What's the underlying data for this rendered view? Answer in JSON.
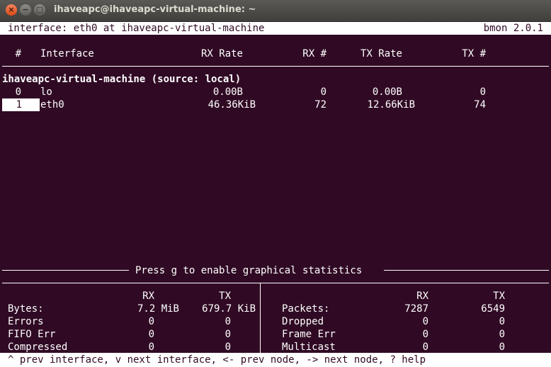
{
  "window": {
    "title": "ihaveapc@ihaveapc-virtual-machine: ~",
    "close_glyph": "×",
    "minimize_glyph": "−",
    "maximize_glyph": "□"
  },
  "status": {
    "left": "interface: eth0 at ihaveapc-virtual-machine",
    "right": "bmon 2.0.1"
  },
  "table": {
    "headers": [
      "#",
      "Interface",
      "RX Rate",
      "RX #",
      "TX Rate",
      "TX #"
    ],
    "host": "ihaveapc-virtual-machine (source: local)",
    "rows": [
      {
        "index": "0",
        "name": "lo",
        "rx_rate": "0.00B",
        "rx_count": "0",
        "tx_rate": "0.00B",
        "tx_count": "0",
        "selected": false
      },
      {
        "index": "1",
        "name": "eth0",
        "rx_rate": "46.36KiB",
        "rx_count": "72",
        "tx_rate": "12.66KiB",
        "tx_count": "74",
        "selected": true
      }
    ]
  },
  "graph_hint": "Press g to enable graphical statistics",
  "stats": {
    "left": {
      "rx_header": "RX",
      "tx_header": "TX",
      "rows": [
        {
          "label": "Bytes:",
          "rx": "7.2 MiB",
          "tx": "679.7 KiB"
        },
        {
          "label": "Errors",
          "rx": "0",
          "tx": "0"
        },
        {
          "label": "FIFO Err",
          "rx": "0",
          "tx": "0"
        },
        {
          "label": "Compressed",
          "rx": "0",
          "tx": "0"
        }
      ]
    },
    "right": {
      "rx_header": "RX",
      "tx_header": "TX",
      "rows": [
        {
          "label": "Packets:",
          "rx": "7287",
          "tx": "6549"
        },
        {
          "label": "Dropped",
          "rx": "0",
          "tx": "0"
        },
        {
          "label": "Frame Err",
          "rx": "0",
          "tx": "0"
        },
        {
          "label": "Multicast",
          "rx": "0",
          "tx": "0"
        }
      ]
    }
  },
  "help_line": "^ prev interface, v next interface, <- prev node, -> next node, ? help"
}
